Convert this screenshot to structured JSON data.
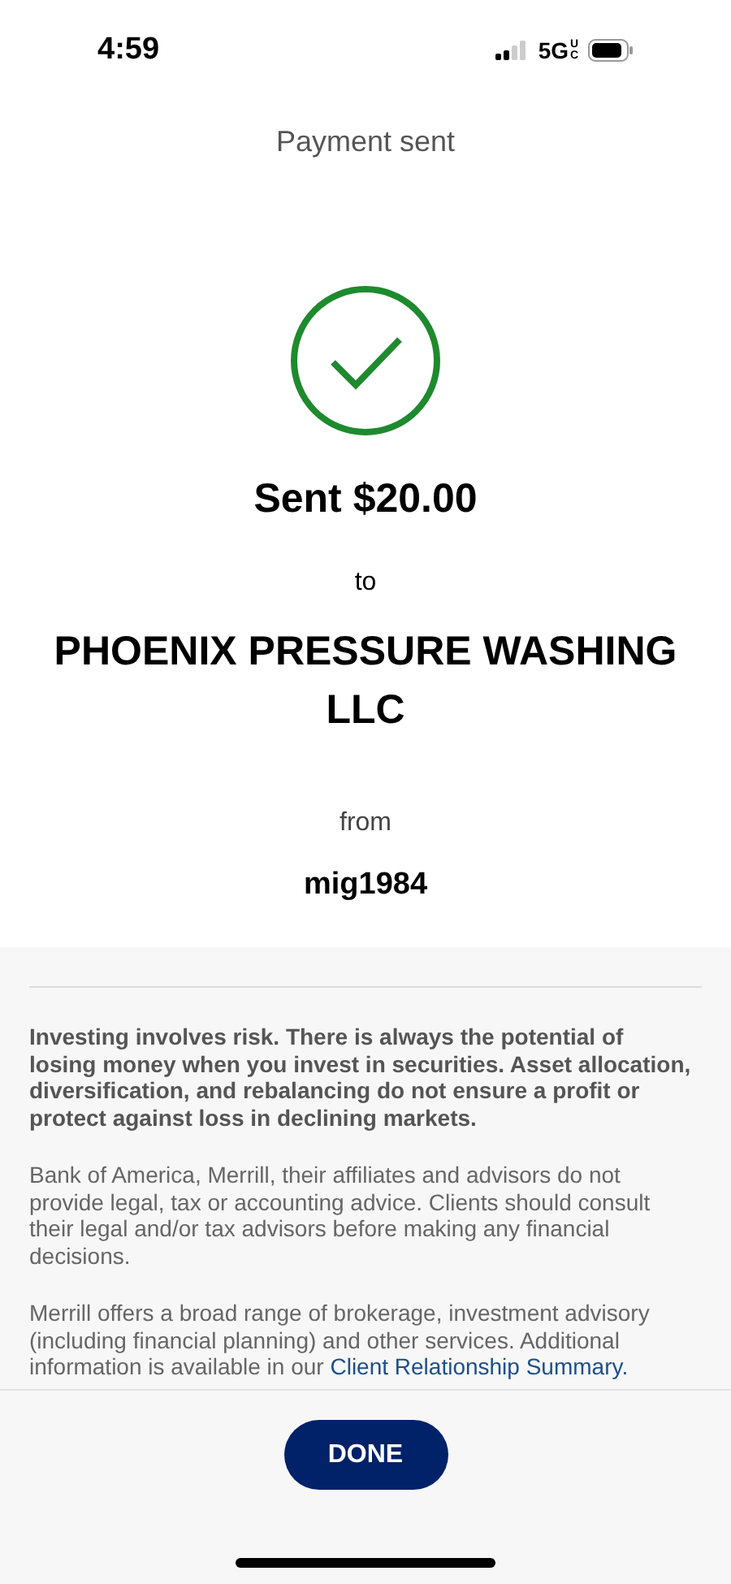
{
  "status_bar": {
    "time": "4:59",
    "network": "5G",
    "network_badge": "UC"
  },
  "header": {
    "title": "Payment sent"
  },
  "confirmation": {
    "amount": "Sent $20.00",
    "to_label": "to",
    "recipient": "PHOENIX PRESSURE WASHING LLC",
    "from_label": "from",
    "sender": "mig1984"
  },
  "disclosures": [
    {
      "kind": "bold",
      "text": "Investing involves risk. There is always the potential of losing money when you invest in securities. Asset allocation, diversification, and rebalancing do not ensure a profit or protect against loss in declining markets."
    },
    {
      "kind": "plain",
      "text": "Bank of America, Merrill, their affiliates and advisors do not provide legal, tax or accounting advice. Clients should consult their legal and/or tax advisors before making any financial decisions."
    },
    {
      "kind": "plain",
      "text": "Merrill offers a broad range of brokerage, investment advisory (including financial planning) and other services. Additional information is available in our ",
      "link": "Client Relationship Summary."
    }
  ],
  "done_button": {
    "label": "DONE"
  }
}
